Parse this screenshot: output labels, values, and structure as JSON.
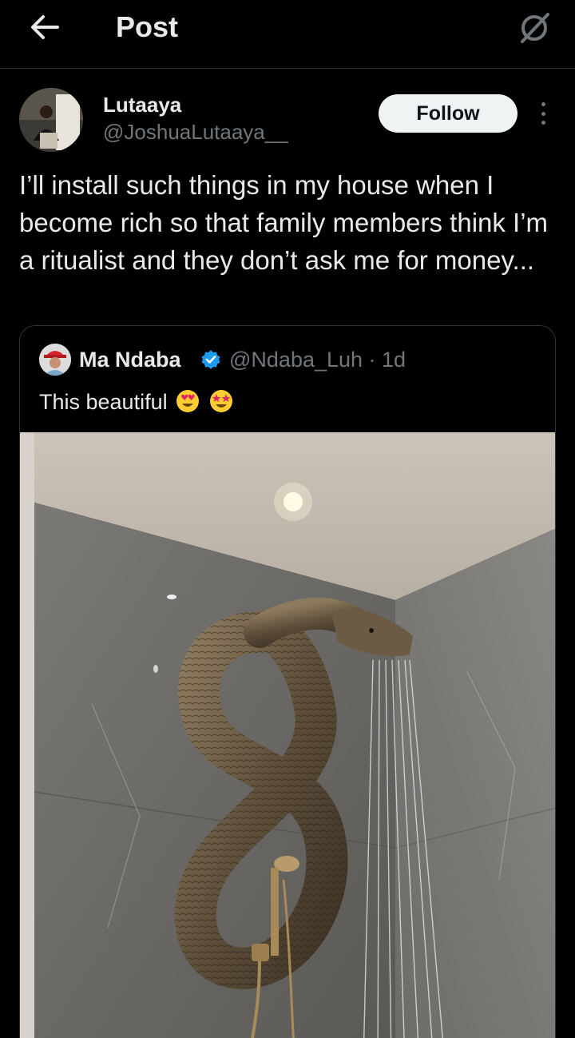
{
  "header": {
    "title": "Post",
    "back_icon": "arrow-left-icon",
    "grok_icon": "grok-icon"
  },
  "author": {
    "name": "Lutaaya",
    "handle": "@JoshuaLutaaya__",
    "follow_label": "Follow"
  },
  "post": {
    "text": "I’ll install such things in my house when I become rich so that family members think I’m a ritualist and they don’t ask me for money..."
  },
  "quote": {
    "name": "Ma Ndaba",
    "handle_time": "@Ndaba_Luh · 1d",
    "text": "This beautiful",
    "emojis": [
      "heart-eyes-emoji",
      "star-struck-emoji"
    ],
    "verified_color": "#1d9bf0"
  },
  "colors": {
    "background": "#000000",
    "text_primary": "#e7e9ea",
    "text_secondary": "#71767b",
    "follow_bg": "#eff3f4"
  }
}
